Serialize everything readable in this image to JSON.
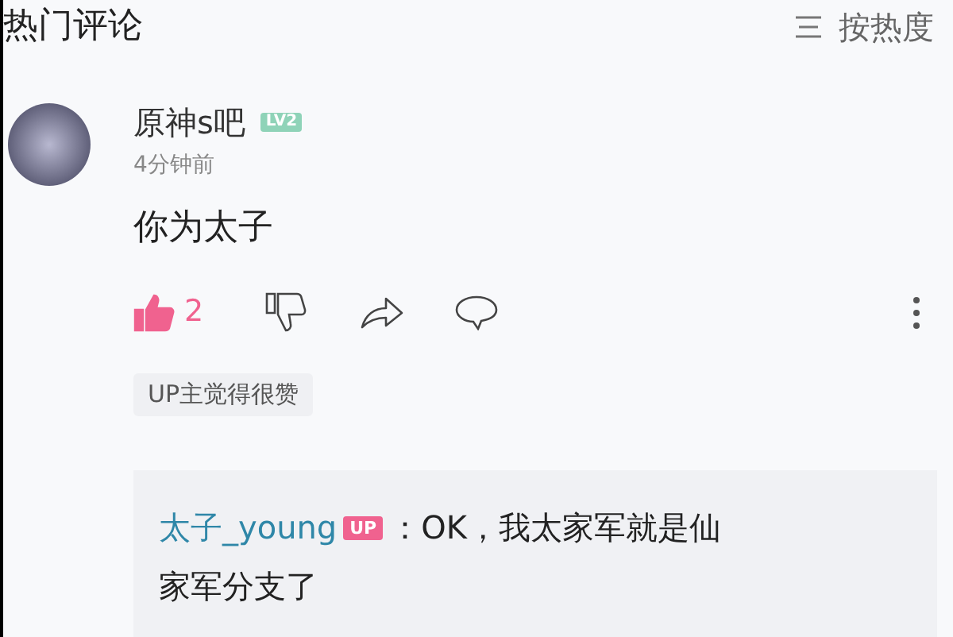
{
  "header": {
    "title": "热门评论",
    "sort_label": "按热度"
  },
  "comment": {
    "username": "原神s吧",
    "level_badge": "LV2",
    "time": "4分钟前",
    "content": "你为太子",
    "liked": true,
    "like_count": "2",
    "tag": "UP主觉得很赞",
    "reply": {
      "author": "太子_young",
      "author_badge": "UP",
      "text_lines": [
        "：OK，我太家军就是仙",
        "家军分支了"
      ]
    }
  }
}
